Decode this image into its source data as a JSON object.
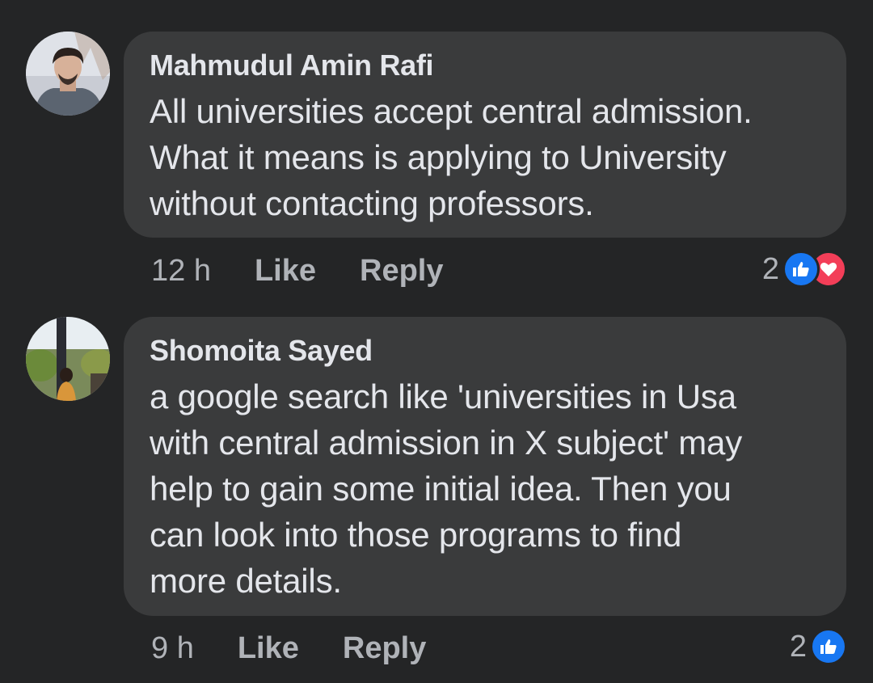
{
  "comments": [
    {
      "author": "Mahmudul Amin Rafi",
      "text_lines": [
        "All universities accept central admission.",
        "What it means is applying to University",
        "without contacting professors."
      ],
      "time": "12 h",
      "like_label": "Like",
      "reply_label": "Reply",
      "reaction_count": "2",
      "reactions": [
        "like-icon",
        "love-icon"
      ]
    },
    {
      "author": "Shomoita Sayed",
      "text_lines": [
        "a google search like 'universities in Usa",
        "with central admission in X subject' may",
        "help to gain some initial idea. Then you",
        "can look into those programs to find",
        "more details."
      ],
      "time": "9 h",
      "like_label": "Like",
      "reply_label": "Reply",
      "reaction_count": "2",
      "reactions": [
        "like-icon"
      ]
    }
  ],
  "colors": {
    "background": "#242526",
    "bubble": "#3a3b3c",
    "primary_text": "#e4e6eb",
    "secondary_text": "#b0b3b8",
    "like_blue": "#1877f2",
    "love_red": "#f33e58"
  }
}
